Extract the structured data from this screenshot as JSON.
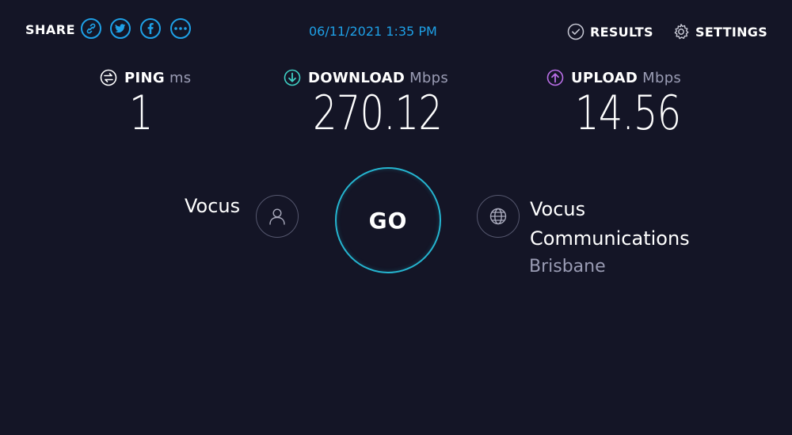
{
  "header": {
    "share_label": "SHARE",
    "share_buttons": [
      "link-icon",
      "twitter-icon",
      "facebook-icon",
      "more-icon"
    ],
    "timestamp": "06/11/2021 1:35 PM",
    "results_label": "RESULTS",
    "settings_label": "SETTINGS"
  },
  "metrics": {
    "ping": {
      "label": "PING",
      "unit": "ms",
      "value": "1",
      "icon": "ping-icon"
    },
    "download": {
      "label": "DOWNLOAD",
      "unit": "Mbps",
      "value": "270.12",
      "icon": "download-icon"
    },
    "upload": {
      "label": "UPLOAD",
      "unit": "Mbps",
      "value": "14.56",
      "icon": "upload-icon"
    }
  },
  "connection": {
    "isp": "Vocus",
    "go_label": "GO",
    "server_name": "Vocus Communications",
    "server_location": "Brisbane"
  },
  "colors": {
    "background": "#141526",
    "accent_blue": "#1ea0e6",
    "download_teal": "#3fd0c4",
    "upload_purple": "#b96ee6",
    "go_ring": "#25b5d0",
    "muted_text": "#9a9cb4"
  }
}
